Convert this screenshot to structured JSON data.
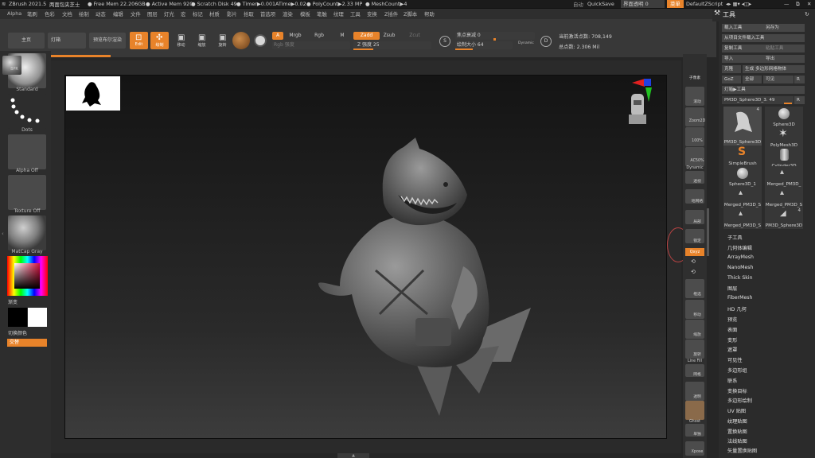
{
  "titlebar": {
    "app": "ZBrush 2021.5",
    "author": "两面包夹芝士",
    "free_mem": "● Free Mem 22.206GB",
    "active_mem": "● Active Mem 920",
    "scratch": "● Scratch Disk 49",
    "timer": "● Timer▶0.001",
    "atime": "ATime▶0.02",
    "polycount": "● PolyCount▶2.33 MP",
    "meshcount": "● MeshCount▶4",
    "autosave": "自动",
    "quicksave": "QuickSave",
    "transparency": "界面透明 0",
    "menu_btn": "菜单",
    "default_script": "DefaultZScript"
  },
  "menu": [
    "Alpha",
    "笔刷",
    "色彩",
    "文档",
    "绘制",
    "动态",
    "编辑",
    "文件",
    "图层",
    "灯光",
    "宏",
    "标记",
    "材质",
    "影片",
    "拾取",
    "首选项",
    "渲染",
    "模板",
    "笔触",
    "纹理",
    "工具",
    "变换",
    "Z插件",
    "Z脚本",
    "帮助"
  ],
  "toolbar": {
    "home": "主页",
    "lightbox": "灯箱",
    "preview_render": "预览布尔渲染",
    "edit": "Edit",
    "draw": "绘制",
    "move": "移动",
    "scale": "缩放",
    "rotate": "旋转",
    "a_btn": "A",
    "mrgb": "Mrgb",
    "rgb": "Rgb",
    "m": "M",
    "zadd": "Zadd",
    "zsub": "Zsub",
    "zcut": "Zcut",
    "rgb_intensity": "Rgb 强度",
    "z_intensity": "Z 强度 25",
    "focal_shift": "焦点衰减 0",
    "draw_size": "绘制大小 64",
    "dynamic": "Dynamic",
    "active_points": "当前激活点数: 708,149",
    "total_points": "总点数: 2.306 Mil"
  },
  "leftshelf": {
    "brush": "Standard",
    "stroke": "Dots",
    "alpha": "Alpha Off",
    "texture": "Texture Off",
    "material": "MatCap Gray",
    "gradient": "渐变",
    "switch_color": "切换颜色",
    "alternate": "交替"
  },
  "rightshelf": {
    "bpr": "BPR",
    "subpixel": "子像素",
    "scroll": "滚动",
    "zoom2d": "Zoom2D",
    "pct100": "100%",
    "ac50": "AC50%",
    "dynamic": "Dynamic",
    "persp": "透视",
    "floor": "地网格",
    "local": "局部",
    "lsym": "锁定",
    "xyz": "Qxyz",
    "frame": "框选",
    "move": "移动",
    "zoom3d": "缩放",
    "rotate": "旋转",
    "linefill": "Line Fill",
    "polyf": "网格",
    "transp": "透明",
    "ghost": "Ghost",
    "solo": "单独",
    "xpose": "Xpose"
  },
  "tool_panel": {
    "title": "工具",
    "load_tool": "载入工具",
    "save_as": "另存为",
    "load_from_project": "从项目文件载入工具",
    "copy_tool": "复制工具",
    "paste_tool": "粘贴工具",
    "import": "导入",
    "export": "导出",
    "clone": "克隆",
    "make_polymesh": "生成 多边形网格物体",
    "goz": "GoZ",
    "all": "全部",
    "visible": "可见",
    "r": "R",
    "lightbox_tools": "灯箱▶工具",
    "current_tool": "PM3D_Sphere3D_3. 49",
    "count_badge": "4",
    "count_badge2": "4",
    "tools": [
      "PM3D_Sphere3D",
      "Sphere3D",
      "SimpleBrush",
      "PolyMesh3D",
      "Sphere3D_1",
      "Cylinder3D",
      "Merged_PM3D_",
      "Merged_PM3D_S",
      "Merged_PM3D_S",
      "Merged_PM3D_S",
      "Merged_PM3D_S",
      "PM3D_Sphere3D"
    ],
    "subpalettes": [
      "子工具",
      "几何体编辑",
      "ArrayMesh",
      "NanoMesh",
      "Thick Skin",
      "图层",
      "FiberMesh",
      "HD 几何",
      "预览",
      "表面",
      "变形",
      "遮罩",
      "可见性",
      "多边形组",
      "联系",
      "变换目标",
      "多边形绘制",
      "UV 贴图",
      "纹理贴图",
      "置换贴图",
      "法线贴图",
      "矢量置换贴图"
    ]
  },
  "colors": {
    "accent": "#e8832a",
    "background": "#262626",
    "panel": "#2b2b2b"
  }
}
